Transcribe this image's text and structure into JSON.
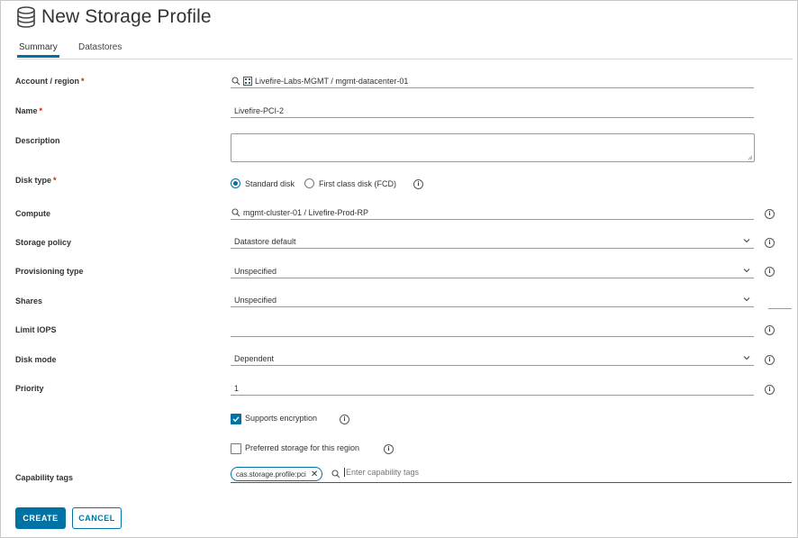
{
  "header": {
    "title": "New Storage Profile",
    "icon": "database-icon"
  },
  "tabs": [
    {
      "label": "Summary",
      "active": true
    },
    {
      "label": "Datastores",
      "active": false
    }
  ],
  "form": {
    "account_region": {
      "label": "Account / region",
      "required": "*",
      "value": "Livefire-Labs-MGMT / mgmt-datacenter-01"
    },
    "name": {
      "label": "Name",
      "required": "*",
      "value": "Livefire-PCI-2"
    },
    "description": {
      "label": "Description",
      "value": ""
    },
    "disk_type": {
      "label": "Disk type",
      "required": "*",
      "options": [
        "Standard disk",
        "First class disk (FCD)"
      ],
      "selected": "Standard disk"
    },
    "compute": {
      "label": "Compute",
      "value": "mgmt-cluster-01 / Livefire-Prod-RP"
    },
    "storage_policy": {
      "label": "Storage policy",
      "value": "Datastore default"
    },
    "provisioning_type": {
      "label": "Provisioning type",
      "value": "Unspecified"
    },
    "shares": {
      "label": "Shares",
      "value": "Unspecified"
    },
    "limit_iops": {
      "label": "Limit IOPS",
      "value": ""
    },
    "disk_mode": {
      "label": "Disk mode",
      "value": "Dependent"
    },
    "priority": {
      "label": "Priority",
      "value": "1"
    },
    "supports_encryption": {
      "label": "Supports encryption",
      "checked": true
    },
    "preferred_storage": {
      "label": "Preferred storage for this region",
      "checked": false
    },
    "capability_tags": {
      "label": "Capability tags",
      "tags": [
        "cas.storage.profile:pci"
      ],
      "placeholder": "Enter capability tags"
    }
  },
  "buttons": {
    "create": "CREATE",
    "cancel": "CANCEL"
  },
  "colors": {
    "accent": "#0072a3",
    "required": "#c92100"
  }
}
